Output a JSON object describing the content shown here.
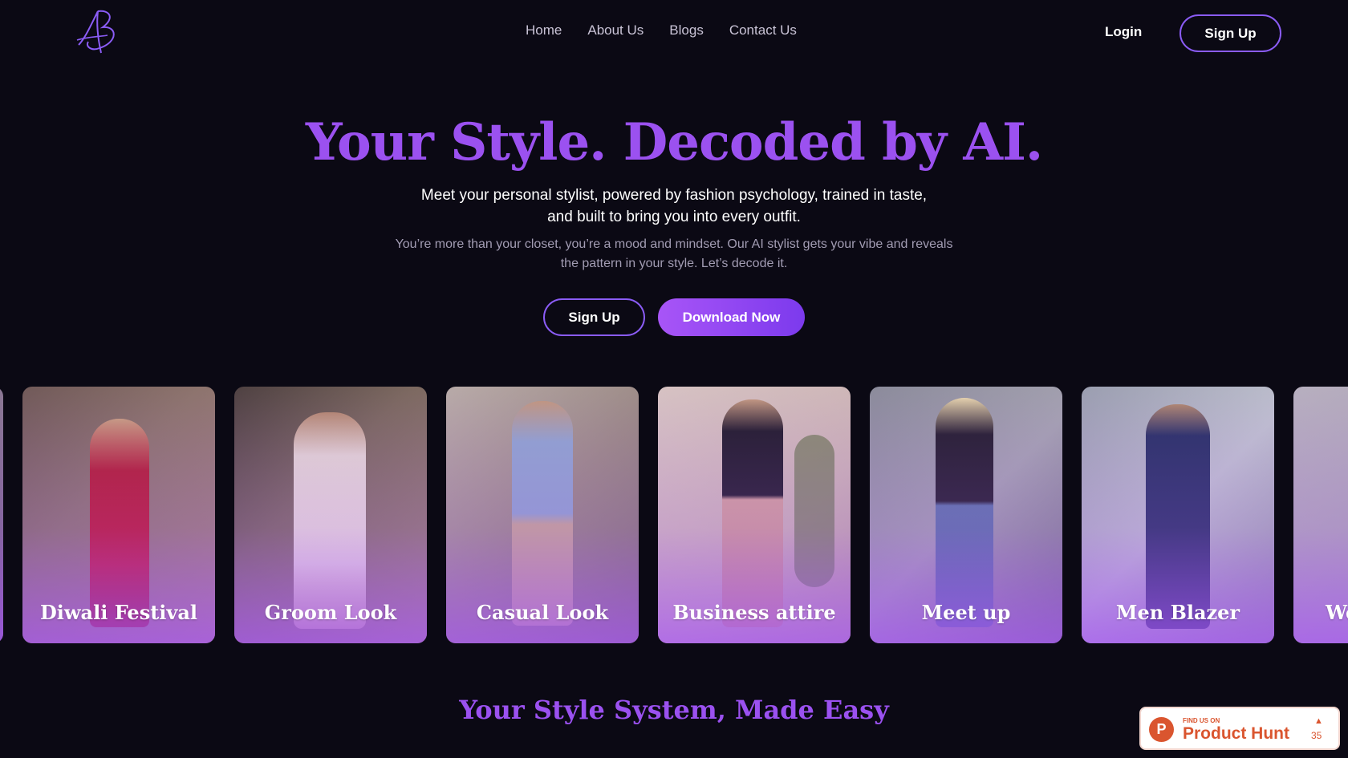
{
  "nav": {
    "logo_icon": "ab-monogram-icon",
    "links": [
      "Home",
      "About Us",
      "Blogs",
      "Contact Us"
    ],
    "login": "Login",
    "signup": "Sign Up"
  },
  "hero": {
    "title": "Your Style. Decoded by AI.",
    "subtitle_line1": "Meet your personal stylist, powered by fashion psychology, trained in taste,",
    "subtitle_line2": "and built to bring you into every outfit.",
    "desc_line1": "You’re more than your closet, you’re a mood and mindset. Our AI stylist gets your vibe and reveals",
    "desc_line2": "the pattern in your style. Let’s decode it.",
    "signup": "Sign Up",
    "download": "Download Now"
  },
  "looks": [
    {
      "label": "Diwali Festival"
    },
    {
      "label": "Groom Look"
    },
    {
      "label": "Casual Look"
    },
    {
      "label": "Business attire"
    },
    {
      "label": "Meet up"
    },
    {
      "label": "Men Blazer"
    },
    {
      "label": "We"
    }
  ],
  "section": {
    "title": "Your Style System, Made Easy"
  },
  "product_hunt": {
    "icon": "product-hunt-icon",
    "find_us": "FIND US ON",
    "name": "Product Hunt",
    "upvote_icon": "upvote-arrow-icon",
    "count": "35"
  },
  "colors": {
    "background": "#0b0914",
    "accent": "#9b51f0",
    "button_gradient_start": "#a855f7",
    "button_gradient_end": "#7c3aed",
    "product_hunt": "#da552f"
  }
}
